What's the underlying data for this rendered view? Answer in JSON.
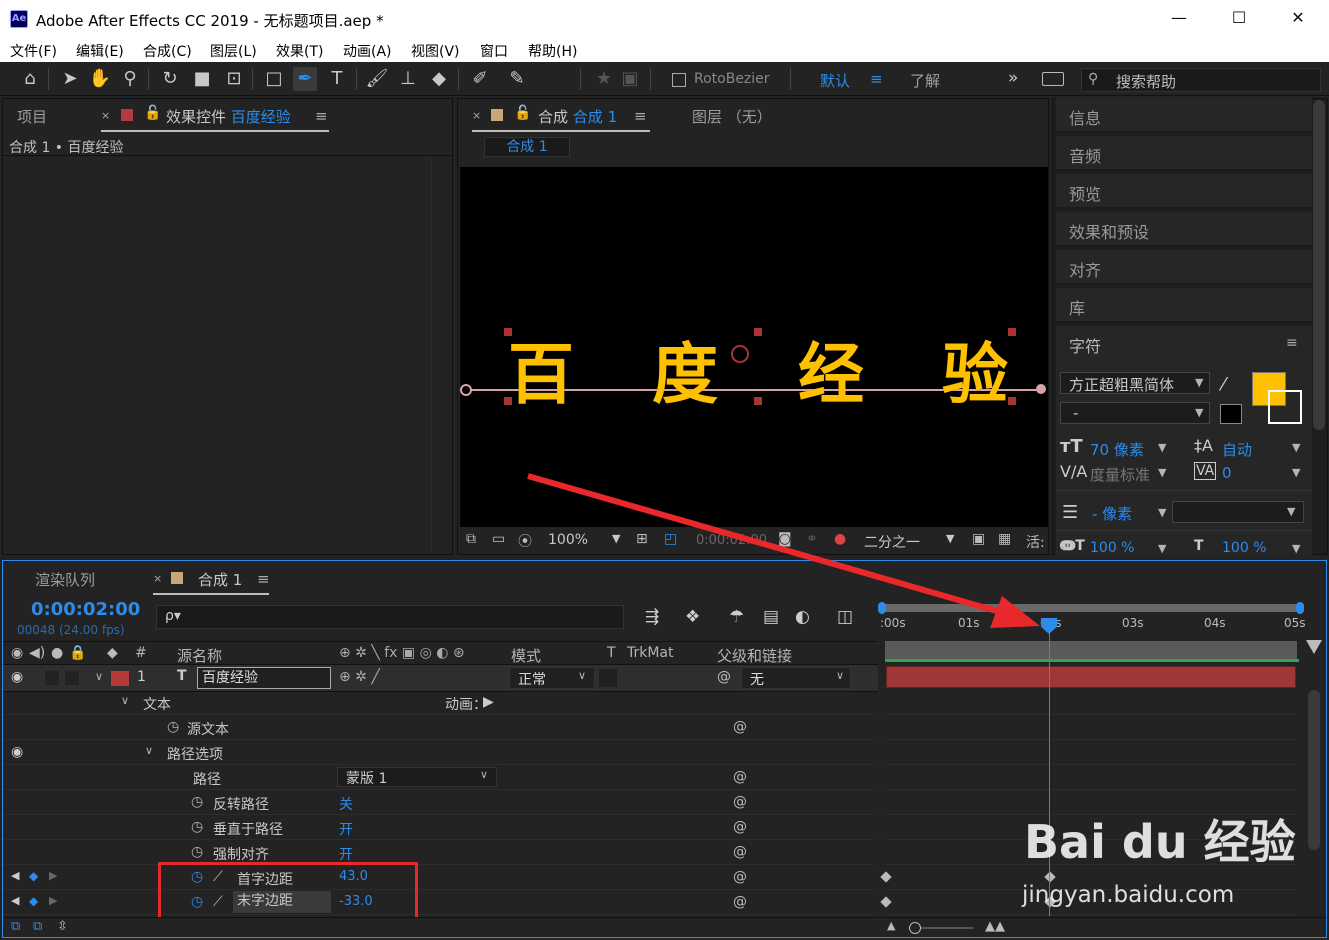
{
  "window": {
    "title": "Adobe After Effects CC 2019 - 无标题项目.aep *",
    "logo": "Ae",
    "minimize": "—",
    "maximize": "☐",
    "close": "✕"
  },
  "menu": [
    "文件(F)",
    "编辑(E)",
    "合成(C)",
    "图层(L)",
    "效果(T)",
    "动画(A)",
    "视图(V)",
    "窗口",
    "帮助(H)"
  ],
  "toolbar": {
    "rotobezier": "RotoBezier",
    "workspace_default": "默认",
    "workspace_learn": "了解",
    "more": "»",
    "search_placeholder": "搜索帮助"
  },
  "left_panel": {
    "tab_project": "项目",
    "tab_effects_prefix": "效果控件",
    "tab_effects_layer": "百度经验",
    "breadcrumb": "合成 1 • 百度经验"
  },
  "comp_panel": {
    "tab_label": "合成",
    "tab_name": "合成 1",
    "layer_tab": "图层 （无）",
    "sub_tab": "合成 1",
    "glyphs": [
      "百",
      "度",
      "经",
      "验"
    ],
    "zoom": "100%",
    "timecode": "0:00:02:00",
    "resolution": "二分之一",
    "active_camera": "活:"
  },
  "right_panel": {
    "items": [
      "信息",
      "音频",
      "预览",
      "效果和预设",
      "对齐",
      "库"
    ],
    "char_title": "字符",
    "font_name": "方正超粗黑简体",
    "font_style": "-",
    "font_size": "70 像素",
    "leading": "自动",
    "kerning": "度量标准",
    "tracking": "0",
    "stroke_width": "- 像素",
    "vscale": "100 %",
    "hscale": "100 %",
    "fill_color": "#ffc000"
  },
  "timeline": {
    "tab_render": "渲染队列",
    "tab_comp": "合成 1",
    "timecode": "0:00:02:00",
    "frame_info": "00048 (24.00 fps)",
    "search_placeholder": "ρ▾",
    "headers": {
      "num": "#",
      "source": "源名称",
      "mode": "模式",
      "t": "T",
      "trkmat": "TrkMat",
      "parent": "父级和链接"
    },
    "layer": {
      "index": "1",
      "name": "百度经验",
      "mode": "正常",
      "parent": "无"
    },
    "animate_label": "动画：",
    "rows": [
      {
        "label": "文本"
      },
      {
        "label": "源文本"
      },
      {
        "label": "路径选项"
      },
      {
        "label": "路径",
        "value": "蒙版 1"
      },
      {
        "label": "反转路径",
        "value": "关"
      },
      {
        "label": "垂直于路径",
        "value": "开"
      },
      {
        "label": "强制对齐",
        "value": "开"
      },
      {
        "label": "首字边距",
        "value": "43.0"
      },
      {
        "label": "末字边距",
        "value": "-33.0"
      }
    ],
    "ruler": [
      ":00s",
      "01s",
      "02s",
      "03s",
      "04s",
      "05s"
    ]
  },
  "watermark": {
    "brand": "Bai du 经验",
    "url": "jingyan.baidu.com"
  },
  "colors": {
    "accent": "#2d8ceb",
    "layer_label": "#b53b3b",
    "text_fill": "#ffc000",
    "annotation": "#e8282a"
  }
}
